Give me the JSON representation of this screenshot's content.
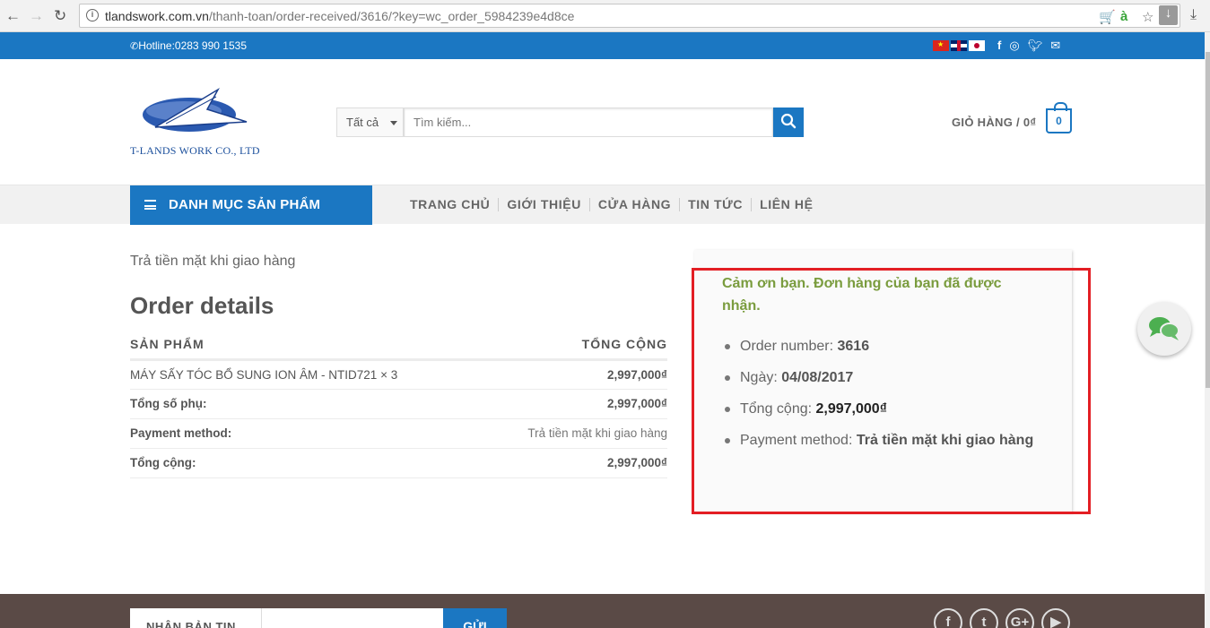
{
  "browser": {
    "url_host": "tlandswork.com.vn",
    "url_path": "/thanh-toan/order-received/3616/?key=wc_order_5984239e4d8ce"
  },
  "topbar": {
    "hotline": "Hotline:0283 990 1535"
  },
  "header": {
    "logo_text": "T-LANDS WORK CO., LTD",
    "category_select": "Tất cả",
    "search_placeholder": "Tìm kiếm...",
    "cart_label": "GIỎ HÀNG / 0₫",
    "cart_count": "0"
  },
  "nav": {
    "category_menu": "DANH MỤC SẢN PHẨM",
    "items": [
      "TRANG CHỦ",
      "GIỚI THIỆU",
      "CỬA HÀNG",
      "TIN TỨC",
      "LIÊN HỆ"
    ]
  },
  "main": {
    "payment_note": "Trả tiền mặt khi giao hàng",
    "order_title": "Order details",
    "table": {
      "headers": [
        "SẢN PHẨM",
        "TỔNG CỘNG"
      ],
      "rows": [
        [
          "MÁY SẤY TÓC BỔ SUNG ION ÂM - NTID721 × 3",
          "2,997,000₫"
        ],
        [
          "Tổng số phụ:",
          "2,997,000₫"
        ],
        [
          "Payment method:",
          "Trả tiền mặt khi giao hàng"
        ],
        [
          "Tổng cộng:",
          "2,997,000₫"
        ]
      ]
    }
  },
  "summary": {
    "thanks": "Cảm ơn bạn. Đơn hàng của bạn đã được nhận.",
    "items": [
      {
        "label": "Order number:",
        "value": "3616"
      },
      {
        "label": "Ngày:",
        "value": "04/08/2017"
      },
      {
        "label": "Tổng cộng:",
        "value": "2,997,000₫"
      },
      {
        "label": "Payment method:",
        "value": "Trả tiền mặt khi giao hàng"
      }
    ]
  },
  "footer": {
    "newsletter_label": "NHẬN BẢN TIN",
    "send_button": "GỬI"
  },
  "colors": {
    "brand_blue": "#1b77c2",
    "thanks_green": "#7a9c3e",
    "highlight_red": "#e31e24"
  }
}
